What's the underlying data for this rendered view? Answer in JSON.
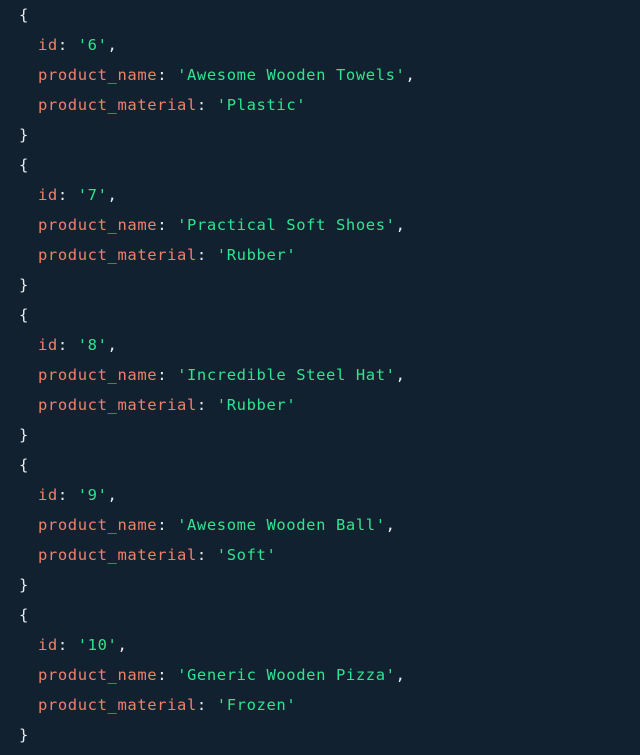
{
  "colors": {
    "background": "#12212f",
    "key": "#f0806a",
    "string": "#2ee58f",
    "punctuation": "#e8edf1"
  },
  "labels": {
    "open_brace": "{",
    "close_brace": "}",
    "key_separator": ": ",
    "comma": ","
  },
  "records": [
    {
      "fields": [
        {
          "key": "id",
          "value": "'6'"
        },
        {
          "key": "product_name",
          "value": "'Awesome Wooden Towels'"
        },
        {
          "key": "product_material",
          "value": "'Plastic'"
        }
      ]
    },
    {
      "fields": [
        {
          "key": "id",
          "value": "'7'"
        },
        {
          "key": "product_name",
          "value": "'Practical Soft Shoes'"
        },
        {
          "key": "product_material",
          "value": "'Rubber'"
        }
      ]
    },
    {
      "fields": [
        {
          "key": "id",
          "value": "'8'"
        },
        {
          "key": "product_name",
          "value": "'Incredible Steel Hat'"
        },
        {
          "key": "product_material",
          "value": "'Rubber'"
        }
      ]
    },
    {
      "fields": [
        {
          "key": "id",
          "value": "'9'"
        },
        {
          "key": "product_name",
          "value": "'Awesome Wooden Ball'"
        },
        {
          "key": "product_material",
          "value": "'Soft'"
        }
      ]
    },
    {
      "fields": [
        {
          "key": "id",
          "value": "'10'"
        },
        {
          "key": "product_name",
          "value": "'Generic Wooden Pizza'"
        },
        {
          "key": "product_material",
          "value": "'Frozen'"
        }
      ]
    }
  ]
}
